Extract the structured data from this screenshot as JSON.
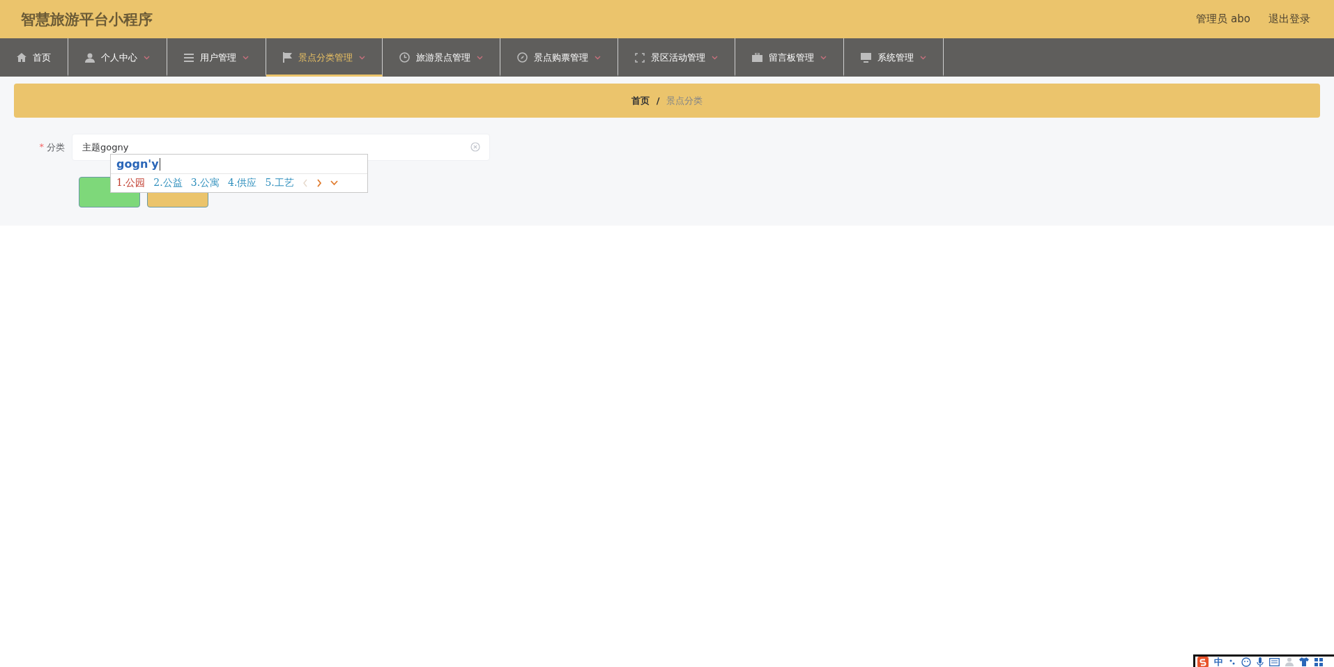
{
  "header": {
    "title": "智慧旅游平台小程序",
    "user": "管理员 abo",
    "logout": "退出登录"
  },
  "nav": [
    {
      "label": "首页",
      "caret": false,
      "selected": false
    },
    {
      "label": "个人中心",
      "caret": true,
      "selected": false
    },
    {
      "label": "用户管理",
      "caret": true,
      "selected": false
    },
    {
      "label": "景点分类管理",
      "caret": true,
      "selected": true
    },
    {
      "label": "旅游景点管理",
      "caret": true,
      "selected": false
    },
    {
      "label": "景点购票管理",
      "caret": true,
      "selected": false
    },
    {
      "label": "景区活动管理",
      "caret": true,
      "selected": false
    },
    {
      "label": "留言板管理",
      "caret": true,
      "selected": false
    },
    {
      "label": "系统管理",
      "caret": true,
      "selected": false
    }
  ],
  "breadcrumb": {
    "items": [
      {
        "label": "首页",
        "current": false
      },
      {
        "label": "景点分类",
        "current": true
      }
    ],
    "separator": "/"
  },
  "form": {
    "fields": [
      {
        "label": "分类",
        "required_mark": "*",
        "value": "主题gogny"
      }
    ],
    "buttons": [
      {
        "kind": "submit"
      },
      {
        "kind": "cancel"
      }
    ]
  },
  "ime": {
    "composition": "gogn'y",
    "candidates": [
      {
        "text": "1.公园",
        "selected": true
      },
      {
        "text": "2.公益",
        "selected": false
      },
      {
        "text": "3.公寓",
        "selected": false
      },
      {
        "text": "4.供应",
        "selected": false
      },
      {
        "text": "5.工艺",
        "selected": false
      }
    ]
  },
  "ime_toolbar": {
    "mode": "中"
  }
}
